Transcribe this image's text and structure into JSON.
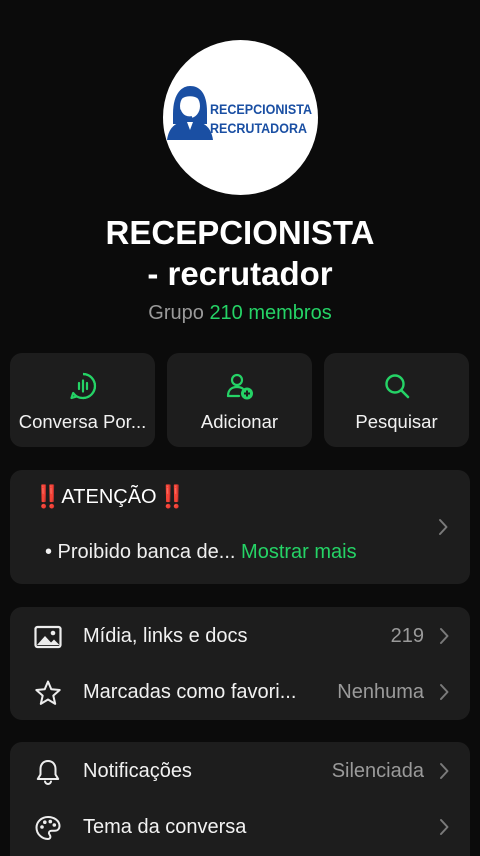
{
  "group": {
    "logo_text_line1": "RECEPCIONISTA",
    "logo_text_line2": "RECRUTADORA",
    "name_line1": "RECEPCIONISTA",
    "name_line2": "- recrutador",
    "type_label": "Grupo",
    "members_label": "210 membros"
  },
  "actions": [
    {
      "label": "Conversa Por...",
      "icon": "voice-chat-icon"
    },
    {
      "label": "Adicionar",
      "icon": "add-person-icon"
    },
    {
      "label": "Pesquisar",
      "icon": "search-icon"
    }
  ],
  "description": {
    "title_emoji": "‼️",
    "title_text": "ATENÇÃO",
    "preview_text": "• Proibido banca de...",
    "more_label": "Mostrar mais"
  },
  "list_primary": [
    {
      "label": "Mídia, links e docs",
      "value": "219",
      "icon": "image-icon"
    },
    {
      "label": "Marcadas como favori...",
      "value": "Nenhuma",
      "icon": "star-icon"
    }
  ],
  "list_secondary": [
    {
      "label": "Notificações",
      "value": "Silenciada",
      "icon": "bell-icon"
    },
    {
      "label": "Tema da conversa",
      "value": "",
      "icon": "palette-icon"
    }
  ],
  "colors": {
    "accent": "#25d366",
    "background": "#0b0b0b",
    "card": "#1d1d1d",
    "logo_blue": "#1a4fa3",
    "alert_red": "#e0263c"
  }
}
